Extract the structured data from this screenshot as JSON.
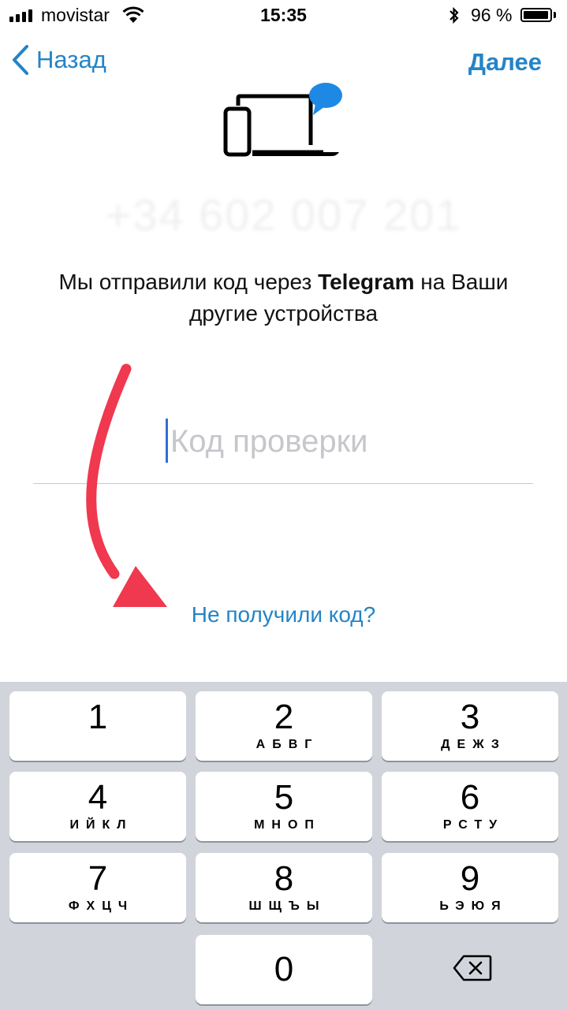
{
  "status_bar": {
    "carrier": "movistar",
    "time": "15:35",
    "battery_percent": "96 %",
    "battery_level": 0.96
  },
  "nav": {
    "back_label": "Назад",
    "next_label": "Далее"
  },
  "phone_number": "+34 602 007 201",
  "message": {
    "part1": "Мы отправили код через ",
    "brand": "Telegram",
    "part2": " на Ваши другие устройства"
  },
  "code_input": {
    "placeholder": "Код проверки",
    "value": ""
  },
  "resend_link": "Не получили код?",
  "colors": {
    "accent": "#2484c6",
    "annotation_arrow": "#f0384f",
    "keypad_bg": "#d1d4da"
  },
  "keypad": {
    "keys": [
      {
        "digit": "1",
        "letters": ""
      },
      {
        "digit": "2",
        "letters": "АБВГ"
      },
      {
        "digit": "3",
        "letters": "ДЕЖЗ"
      },
      {
        "digit": "4",
        "letters": "ИЙКЛ"
      },
      {
        "digit": "5",
        "letters": "МНОП"
      },
      {
        "digit": "6",
        "letters": "РСТУ"
      },
      {
        "digit": "7",
        "letters": "ФХЦЧ"
      },
      {
        "digit": "8",
        "letters": "ШЩЪЫ"
      },
      {
        "digit": "9",
        "letters": "ЬЭЮЯ"
      },
      {
        "digit": "0",
        "letters": ""
      }
    ],
    "delete_icon": "backspace-icon"
  }
}
